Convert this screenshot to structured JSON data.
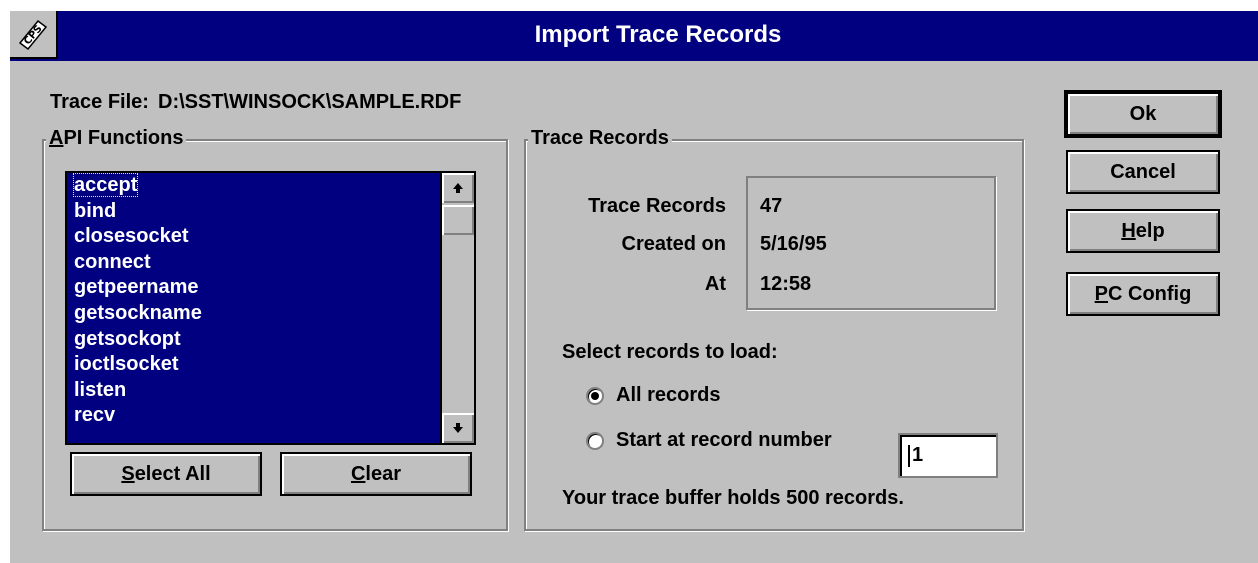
{
  "window": {
    "title": "Import Trace Records",
    "icon": "cps-app-icon"
  },
  "trace_file": {
    "label": "Trace File:",
    "path": "D:\\SST\\WINSOCK\\SAMPLE.RDF"
  },
  "api_functions": {
    "group_title_hotkey": "A",
    "group_title_rest": "PI Functions",
    "items": [
      "accept",
      "bind",
      "closesocket",
      "connect",
      "getpeername",
      "getsockname",
      "getsockopt",
      "ioctlsocket",
      "listen",
      "recv"
    ],
    "select_all_hotkey": "S",
    "select_all_rest": "elect All",
    "clear_hotkey": "C",
    "clear_rest": "lear"
  },
  "trace_records": {
    "group_title": "Trace Records",
    "rows": [
      {
        "label": "Trace Records",
        "value": "47"
      },
      {
        "label": "Created on",
        "value": "5/16/95"
      },
      {
        "label": "At",
        "value": "12:58"
      }
    ],
    "select_prompt": "Select records to load:",
    "option_all": "All records",
    "option_start": "Start at record number",
    "selected_option": "All records",
    "start_number": "1",
    "buffer_note": "Your trace buffer holds 500 records."
  },
  "buttons": {
    "ok": "Ok",
    "cancel": "Cancel",
    "help_hotkey": "H",
    "help_rest": "elp",
    "pcconfig_hotkey": "P",
    "pcconfig_rest": "C Config"
  }
}
